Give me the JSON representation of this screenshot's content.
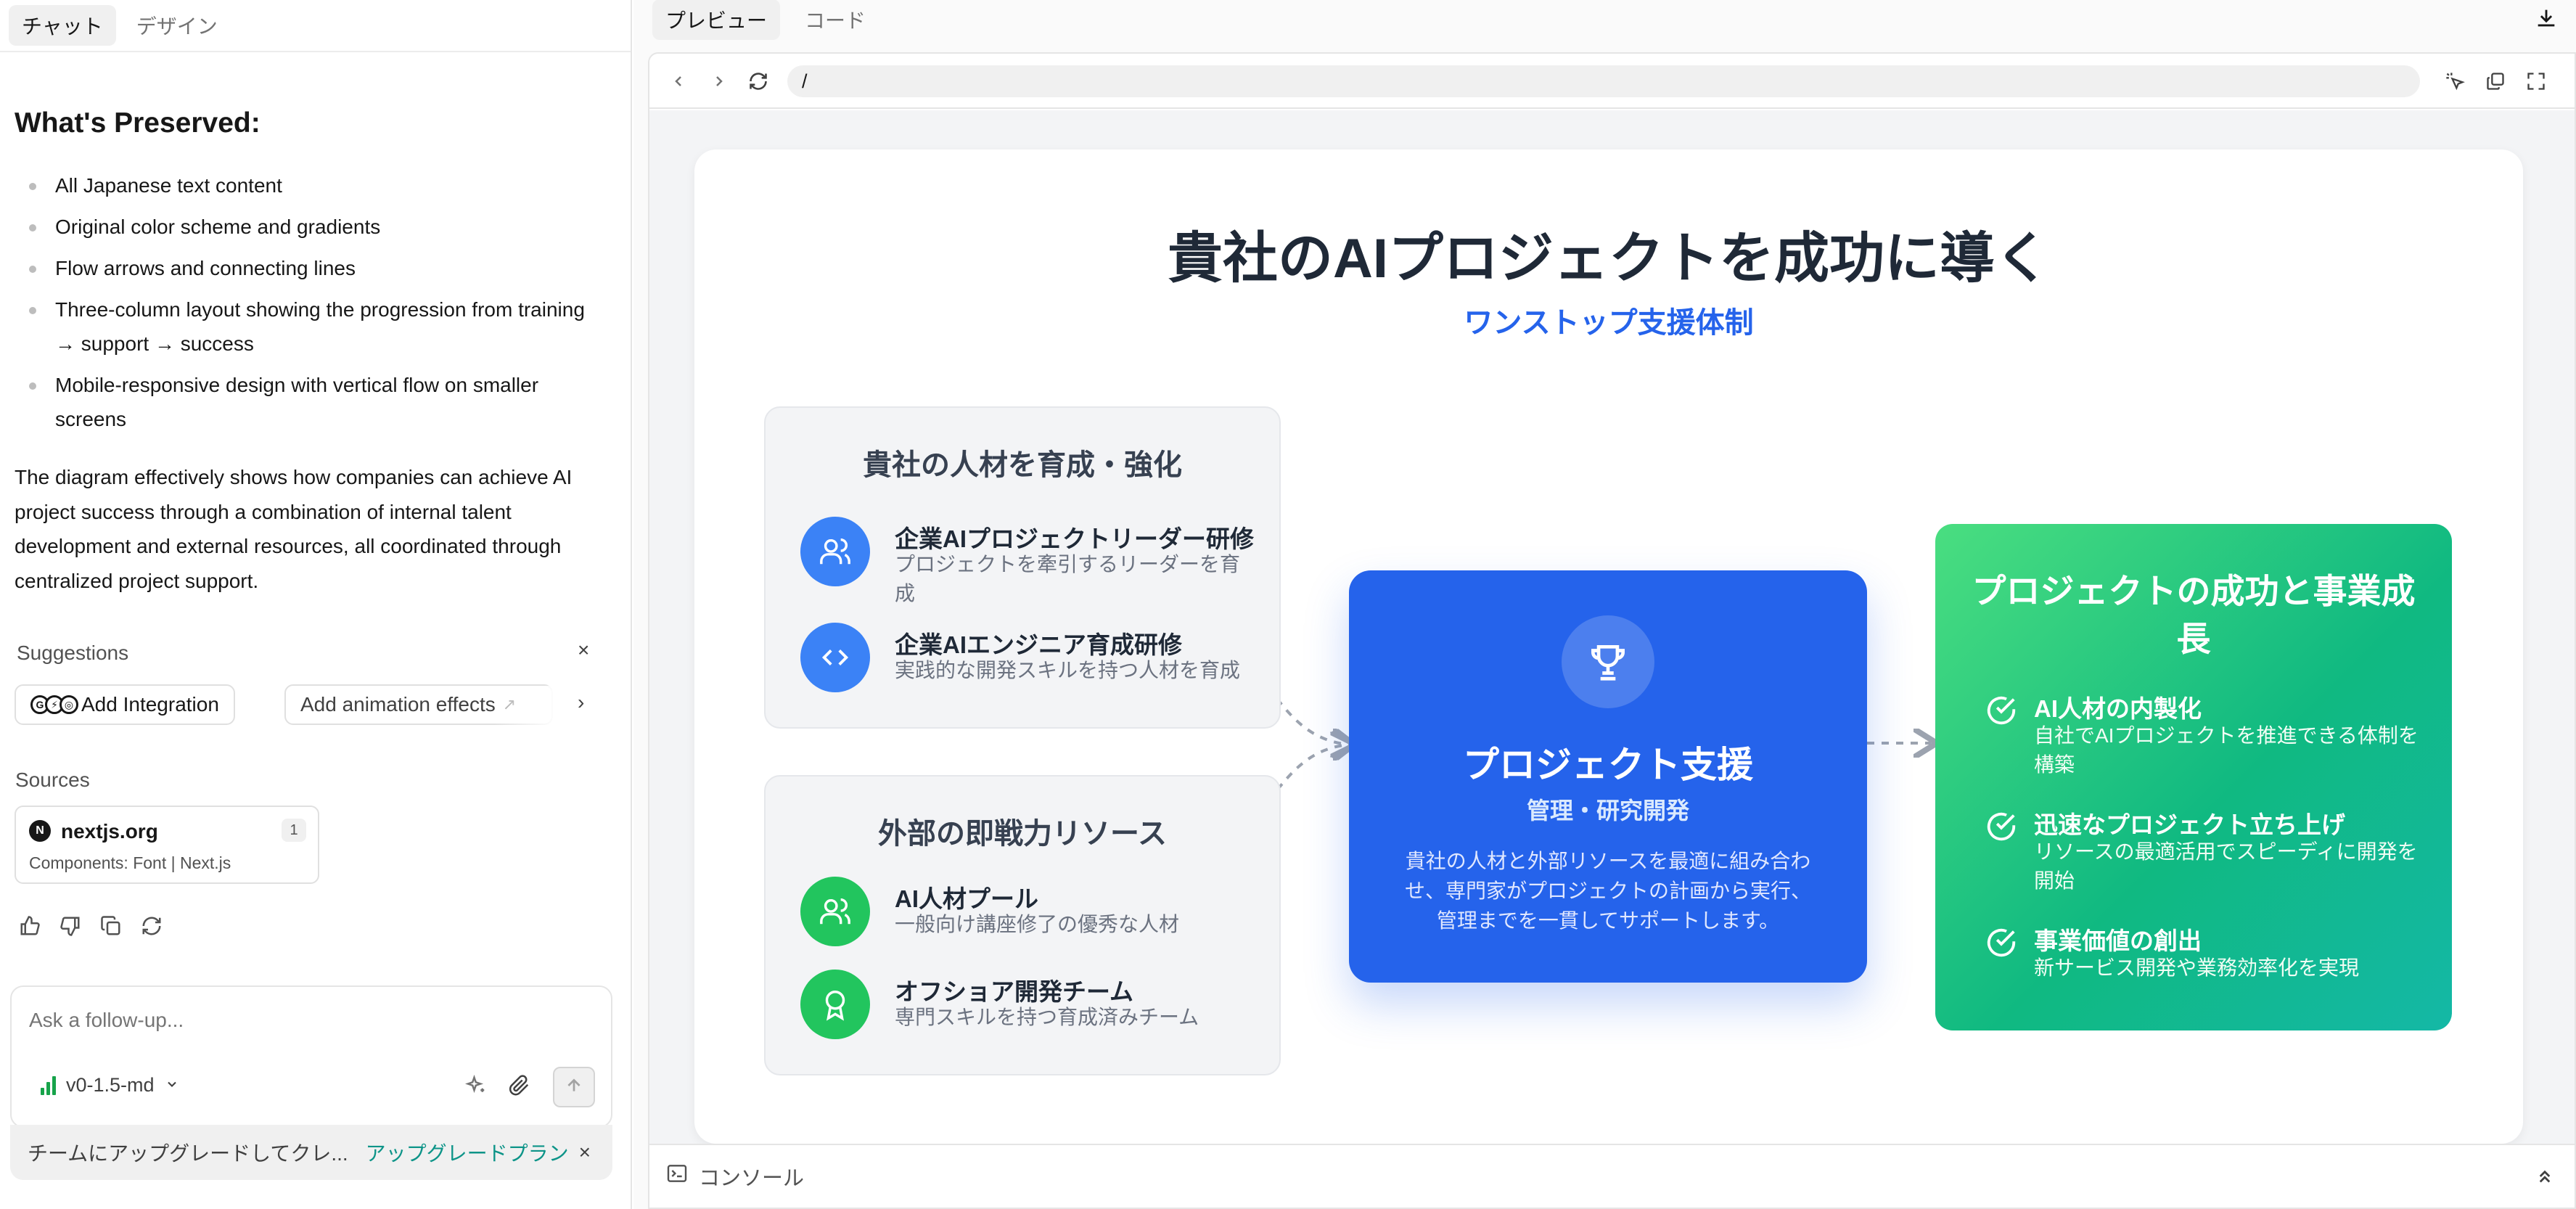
{
  "chat": {
    "tabs": [
      "チャット",
      "デザイン"
    ],
    "heading": "What's Preserved:",
    "bullets": [
      "All Japanese text content",
      "Original color scheme and gradients",
      "Flow arrows and connecting lines",
      "Three-column layout showing the progression from training → support → success",
      "Mobile-responsive design with vertical flow on smaller screens"
    ],
    "paragraph": "The diagram effectively shows how companies can achieve AI project success through a combination of internal talent development and external resources, all coordinated through centralized project support.",
    "suggestions": {
      "label": "Suggestions",
      "close": "×",
      "chips": [
        "Add Integration",
        "Add animation effects"
      ]
    },
    "sources": {
      "label": "Sources",
      "items": [
        {
          "name": "nextjs.org",
          "count": "1",
          "subtitle": "Components: Font | Next.js"
        }
      ]
    },
    "composer": {
      "placeholder": "Ask a follow-up...",
      "model": "v0-1.5-md"
    },
    "upgrade": {
      "text": "チームにアップグレードしてクレ...",
      "link": "アップグレードプラン",
      "close": "×"
    }
  },
  "preview": {
    "tabs": [
      "プレビュー",
      "コード"
    ],
    "url": "/",
    "console_label": "コンソール",
    "page": {
      "title": "貴社のAIプロジェクトを成功に導く",
      "subtitle": "ワンストップ支援体制",
      "left_top": {
        "heading": "貴社の人材を育成・強化",
        "items": [
          {
            "icon": "users-icon",
            "title": "企業AIプロジェクトリーダー研修",
            "desc": "プロジェクトを牽引するリーダーを育成"
          },
          {
            "icon": "code-icon",
            "title": "企業AIエンジニア育成研修",
            "desc": "実践的な開発スキルを持つ人材を育成"
          }
        ]
      },
      "left_bottom": {
        "heading": "外部の即戦力リソース",
        "items": [
          {
            "icon": "users-icon",
            "title": "AI人材プール",
            "desc": "一般向け講座修了の優秀な人材"
          },
          {
            "icon": "award-icon",
            "title": "オフショア開発チーム",
            "desc": "専門スキルを持つ育成済みチーム"
          }
        ]
      },
      "center": {
        "icon": "trophy-icon",
        "title": "プロジェクト支援",
        "subtitle": "管理・研究開発",
        "desc": "貴社の人材と外部リソースを最適に組み合わせ、専門家がプロジェクトの計画から実行、管理までを一貫してサポートします。"
      },
      "right": {
        "title": "プロジェクトの成功と事業成長",
        "items": [
          {
            "title": "AI人材の内製化",
            "desc": "自社でAIプロジェクトを推進できる体制を構築"
          },
          {
            "title": "迅速なプロジェクト立ち上げ",
            "desc": "リソースの最適活用でスピーディに開発を開始"
          },
          {
            "title": "事業価値の創出",
            "desc": "新サービス開発や業務効率化を実現"
          }
        ]
      },
      "colors": {
        "blue": "#2563eb",
        "green": "#22c55e",
        "gradient_start": "#4ade80",
        "gradient_end": "#14b8a6"
      }
    }
  }
}
